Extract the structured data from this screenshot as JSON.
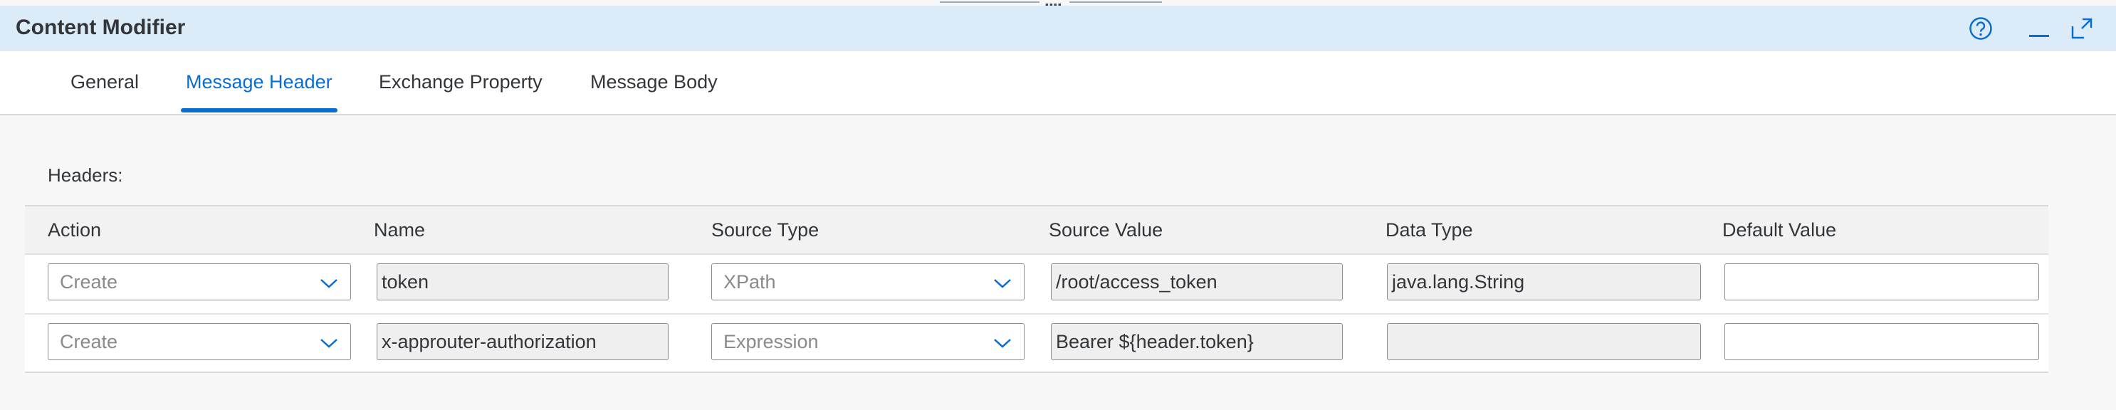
{
  "window": {
    "title": "Content Modifier"
  },
  "tabs": [
    {
      "label": "General"
    },
    {
      "label": "Message Header"
    },
    {
      "label": "Exchange Property"
    },
    {
      "label": "Message Body"
    }
  ],
  "active_tab": "Message Header",
  "section": {
    "label": "Headers:"
  },
  "table": {
    "columns": [
      "Action",
      "Name",
      "Source Type",
      "Source Value",
      "Data Type",
      "Default Value"
    ],
    "rows": [
      {
        "action": "Create",
        "name": "token",
        "source_type": "XPath",
        "source_value": "/root/access_token",
        "data_type": "java.lang.String",
        "default_value": ""
      },
      {
        "action": "Create",
        "name": "x-approuter-authorization",
        "source_type": "Expression",
        "source_value": "Bearer ${header.token}",
        "data_type": "",
        "default_value": ""
      }
    ]
  },
  "colors": {
    "accent": "#0a6ed1",
    "header_bg": "#dcebf8"
  },
  "icons": {
    "help": "help-icon",
    "minimize": "minimize-icon",
    "expand": "expand-icon"
  }
}
